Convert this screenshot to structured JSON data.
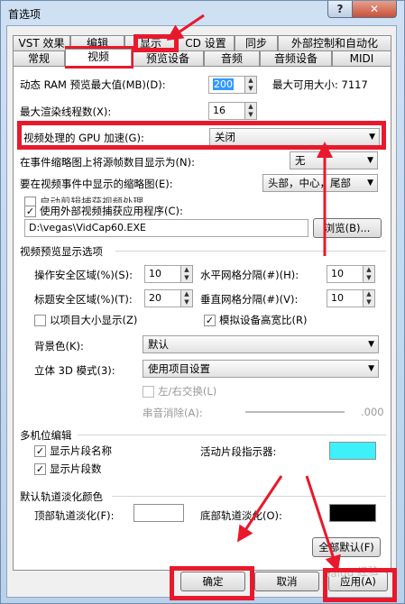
{
  "window": {
    "title": "首选项",
    "help_label": "?",
    "close_label": "✕"
  },
  "tabs_row1": [
    {
      "label": "VST 效果"
    },
    {
      "label": "编辑"
    },
    {
      "label": "显示"
    },
    {
      "label": "CD 设置"
    },
    {
      "label": "同步"
    },
    {
      "label": "外部控制和自动化"
    }
  ],
  "tabs_row2": [
    {
      "label": "常规"
    },
    {
      "label": "视频"
    },
    {
      "label": "预览设备"
    },
    {
      "label": "音频"
    },
    {
      "label": "音频设备"
    },
    {
      "label": "MIDI"
    }
  ],
  "video": {
    "ram_label": "动态 RAM 预览最大值(MB)(D):",
    "ram_value": "200",
    "ram_max": "最大可用大小: 7117",
    "threads_label": "最大渲染线程数(X):",
    "threads_value": "16",
    "gpu_label": "视频处理的 GPU 加速(G):",
    "gpu_value": "关闭",
    "thumb_label": "在事件缩略图上将源帧数目显示为(N):",
    "thumb_value": "无",
    "frames_label": "要在视频事件中显示的缩略图(E):",
    "frames_value": "头部，中心，尾部",
    "capture_overlap": "启动剪辑捕获视频处理",
    "use_external_label": "使用外部视频捕获应用程序(C):",
    "capture_path": "D:\\vegas\\VidCap60.EXE",
    "browse_label": "浏览(B)...",
    "preview_group": "视频预览显示选项",
    "action_safe_label": "操作安全区域(%)(S):",
    "action_safe_value": "10",
    "h_grid_label": "水平网格分隔(#)(H):",
    "h_grid_value": "10",
    "title_safe_label": "标题安全区域(%)(T):",
    "title_safe_value": "20",
    "v_grid_label": "垂直网格分隔(#)(V):",
    "v_grid_value": "10",
    "project_size_label": "以项目大小显示(Z)",
    "simulate_aspect_label": "模拟设备高宽比(R)",
    "bg_label": "背景色(K):",
    "bg_value": "默认",
    "stereo_label": "立体 3D 模式(3):",
    "stereo_value": "使用项目设置",
    "swap_label": "左/右交换(L)",
    "crosstalk_label": "串音消除(A):",
    "crosstalk_value": ".000",
    "multicam_group": "多机位编辑",
    "show_take_names": "显示片段名称",
    "show_takes": "显示片段数",
    "active_take_label": "活动片段指示器:",
    "track_fade_group": "默认轨道淡化颜色",
    "top_fade_label": "顶部轨道淡化(F):",
    "bottom_fade_label": "底部轨道淡化(O):",
    "all_defaults_label": "全部默认(F)"
  },
  "footer": {
    "ok_label": "确定",
    "cancel_label": "取消",
    "apply_label": "应用(A)"
  },
  "watermark": "Baidu 经验",
  "colors": {
    "active_take": "#3ef0fa",
    "top_fade": "#ffffff",
    "bottom_fade": "#000000",
    "highlight": "#e8192c"
  }
}
